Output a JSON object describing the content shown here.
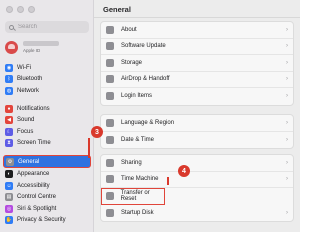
{
  "search": {
    "placeholder": "Search"
  },
  "account": {
    "subtitle": "Apple ID"
  },
  "sidebar": {
    "groups": [
      [
        {
          "label": "Wi-Fi",
          "icon": "wifi-icon",
          "color": "#2f7cf6",
          "glyph": "◉"
        },
        {
          "label": "Bluetooth",
          "icon": "bluetooth-icon",
          "color": "#2f7cf6",
          "glyph": "ᛒ"
        },
        {
          "label": "Network",
          "icon": "network-icon",
          "color": "#2f7cf6",
          "glyph": "◍"
        }
      ],
      [
        {
          "label": "Notifications",
          "icon": "notifications-icon",
          "color": "#e3453c",
          "glyph": "●"
        },
        {
          "label": "Sound",
          "icon": "sound-icon",
          "color": "#e3453c",
          "glyph": "◀"
        },
        {
          "label": "Focus",
          "icon": "focus-icon",
          "color": "#5e5ce6",
          "glyph": "☾"
        },
        {
          "label": "Screen Time",
          "icon": "screen-time-icon",
          "color": "#5e5ce6",
          "glyph": "⧗"
        }
      ],
      [
        {
          "label": "General",
          "icon": "general-gear-icon",
          "color": "#8e8e93",
          "glyph": "⚙",
          "active": true
        },
        {
          "label": "Appearance",
          "icon": "appearance-icon",
          "color": "#1d1d1f",
          "glyph": "◐"
        },
        {
          "label": "Accessibility",
          "icon": "accessibility-icon",
          "color": "#2f7cf6",
          "glyph": "☺"
        },
        {
          "label": "Control Centre",
          "icon": "control-centre-icon",
          "color": "#8e8e93",
          "glyph": "▤"
        },
        {
          "label": "Siri & Spotlight",
          "icon": "siri-icon",
          "color": "#b44be0",
          "glyph": "◎"
        },
        {
          "label": "Privacy & Security",
          "icon": "privacy-icon",
          "color": "#2f7cf6",
          "glyph": "✋"
        }
      ]
    ]
  },
  "main": {
    "title": "General",
    "groups": [
      [
        {
          "label": "About",
          "icon": "about-icon"
        },
        {
          "label": "Software Update",
          "icon": "software-update-icon"
        },
        {
          "label": "Storage",
          "icon": "storage-icon"
        },
        {
          "label": "AirDrop & Handoff",
          "icon": "airdrop-icon"
        },
        {
          "label": "Login Items",
          "icon": "login-items-icon"
        }
      ],
      [
        {
          "label": "Language & Region",
          "icon": "language-region-icon"
        },
        {
          "label": "Date & Time",
          "icon": "date-time-icon"
        }
      ],
      [
        {
          "label": "Sharing",
          "icon": "sharing-icon"
        },
        {
          "label": "Time Machine",
          "icon": "time-machine-icon"
        },
        {
          "label": "Transfer or Reset",
          "icon": "transfer-reset-icon",
          "highlight": true
        },
        {
          "label": "Startup Disk",
          "icon": "startup-disk-icon"
        }
      ]
    ]
  },
  "annotations": {
    "step3": "3",
    "step4": "4"
  }
}
